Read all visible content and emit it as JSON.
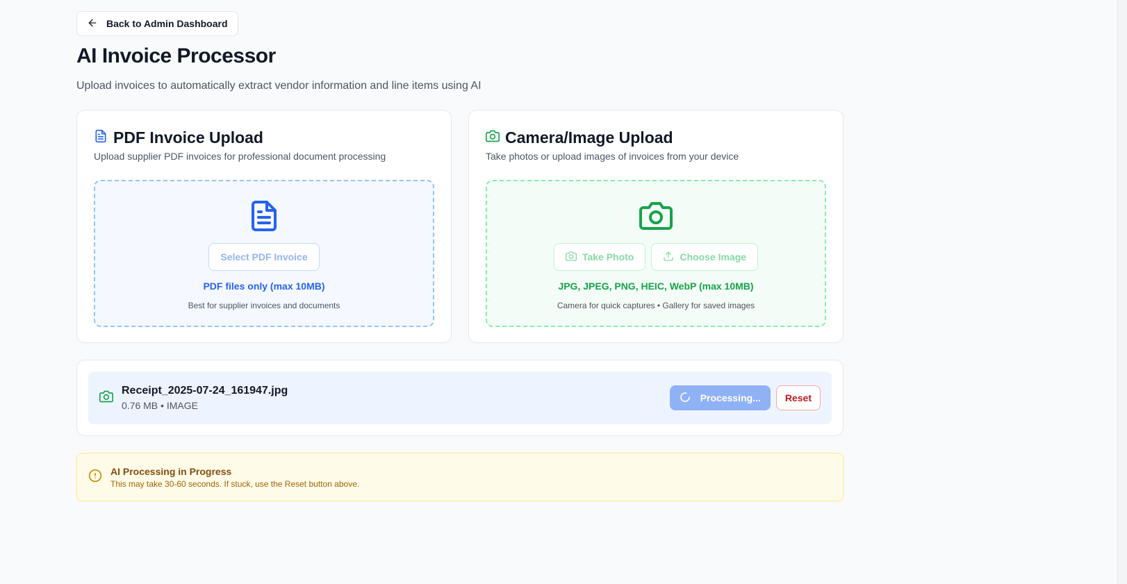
{
  "back_button": {
    "label": "Back to Admin Dashboard",
    "icon": "arrow-left-icon"
  },
  "header": {
    "title": "AI Invoice Processor",
    "subtitle": "Upload invoices to automatically extract vendor information and line items using AI"
  },
  "pdf_card": {
    "icon": "file-text-icon",
    "title": "PDF Invoice Upload",
    "description": "Upload supplier PDF invoices for professional document processing",
    "select_button": "Select PDF Invoice",
    "formats": "PDF files only (max 10MB)",
    "hint": "Best for supplier invoices and documents"
  },
  "image_card": {
    "icon": "camera-icon",
    "title": "Camera/Image Upload",
    "description": "Take photos or upload images of invoices from your device",
    "take_photo_button": "Take Photo",
    "choose_image_button": "Choose Image",
    "formats": "JPG, JPEG, PNG, HEIC, WebP (max 10MB)",
    "hint": "Camera for quick captures • Gallery for saved images"
  },
  "file": {
    "name": "Receipt_2025-07-24_161947.jpg",
    "meta": "0.76 MB • IMAGE",
    "processing_label": "Processing...",
    "reset_label": "Reset"
  },
  "alert": {
    "title": "AI Processing in Progress",
    "body": "This may take 30-60 seconds. If stuck, use the Reset button above."
  },
  "colors": {
    "accent_blue": "#2563eb",
    "accent_green": "#16a34a",
    "danger": "#b91c1c",
    "warning_text": "#854d0e",
    "warning_bg": "#fefce8"
  }
}
